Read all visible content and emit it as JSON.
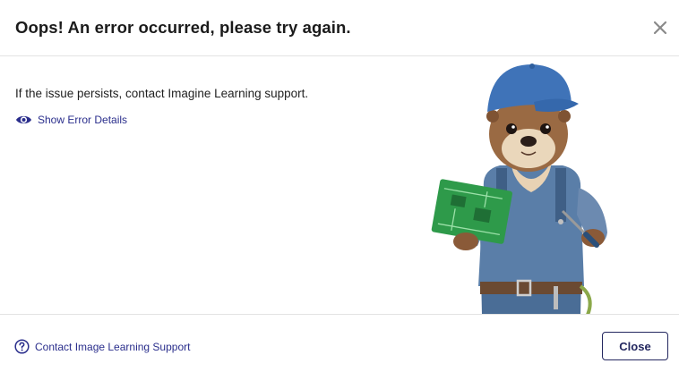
{
  "dialog": {
    "title": "Oops! An error occurred, please try again.",
    "close_icon": "close-icon"
  },
  "body": {
    "message": "If the issue persists, contact Imagine Learning support.",
    "details_link": {
      "icon": "eye-icon",
      "label": "Show Error Details"
    },
    "illustration": "otter-mechanic-illustration"
  },
  "footer": {
    "support_link": {
      "icon": "question-circle-icon",
      "label": "Contact Image Learning Support"
    },
    "close_label": "Close"
  },
  "colors": {
    "link": "#2a2e8c",
    "button_border": "#23275f",
    "divider": "#e3e3e3",
    "title": "#1b1b1b"
  }
}
